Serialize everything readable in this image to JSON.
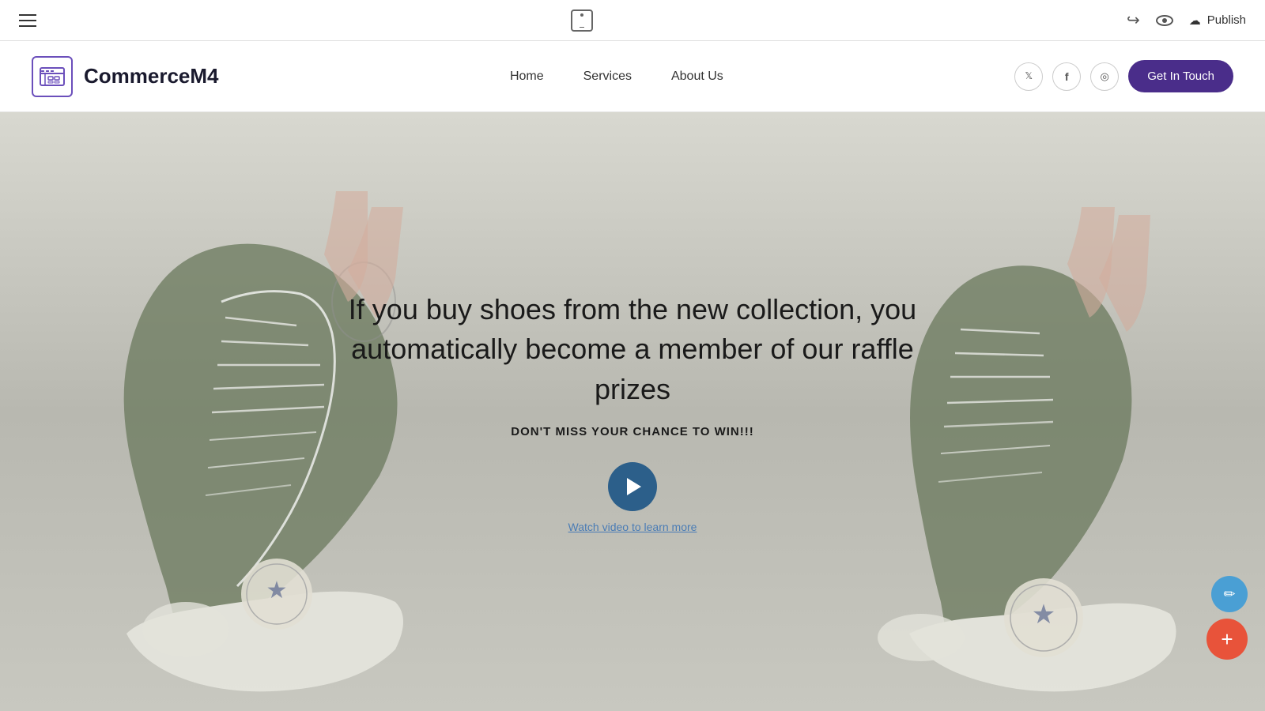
{
  "toolbar": {
    "publish_label": "Publish"
  },
  "header": {
    "logo_name": "CommerceM4",
    "nav": {
      "home": "Home",
      "services": "Services",
      "about_us": "About Us"
    },
    "cta_button": "Get In Touch"
  },
  "hero": {
    "title": "If you buy shoes from the new collection, you automatically become a member of our raffle prizes",
    "subtitle": "DON'T MISS YOUR CHANCE TO WIN!!!",
    "watch_video_text": "Watch video to learn more"
  },
  "social_icons": {
    "twitter": "𝕏",
    "facebook": "f",
    "instagram": "◎"
  },
  "fab": {
    "edit_icon": "✏",
    "add_icon": "+"
  }
}
